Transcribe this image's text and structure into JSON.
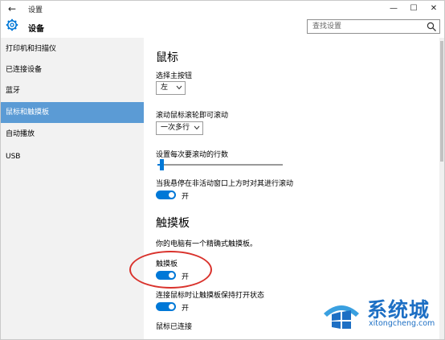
{
  "window": {
    "title": "设置",
    "app_name": "设备"
  },
  "search": {
    "placeholder": "查找设置"
  },
  "sidebar": {
    "items": [
      {
        "label": "打印机和扫描仪"
      },
      {
        "label": "已连接设备"
      },
      {
        "label": "蓝牙"
      },
      {
        "label": "鼠标和触摸板",
        "selected": true
      },
      {
        "label": "自动播放"
      },
      {
        "label": "USB"
      }
    ]
  },
  "mouse": {
    "heading": "鼠标",
    "primary_button_label": "选择主按钮",
    "primary_button_value": "左",
    "scroll_label": "滚动鼠标滚轮即可滚动",
    "scroll_value": "一次多行",
    "lines_label": "设置每次要滚动的行数",
    "lines_slider_level": 0.03,
    "inactive_scroll_label": "当我悬停在非活动窗口上方时对其进行滚动",
    "inactive_scroll_state": "开"
  },
  "touchpad": {
    "heading": "触摸板",
    "description": "你的电脑有一个精确式触摸板。",
    "toggle_label": "触摸板",
    "toggle_state": "开",
    "keep_on_label": "连接鼠标时让触摸板保持打开状态",
    "keep_on_state": "开",
    "mouse_connected_label": "鼠标已连接"
  },
  "watermark": {
    "name": "系统城",
    "url": "xitongcheng.com"
  },
  "colors": {
    "accent": "#0078d7",
    "selected_item": "#5b9bd5",
    "sidebar_bg": "#f2f2f2",
    "annotation_ring": "#d9322c",
    "watermark": "#1d6fc4"
  },
  "icons": {
    "back": "back-arrow-icon",
    "settings": "gear-icon",
    "search": "search-icon",
    "minimize": "minimize-icon",
    "maximize": "maximize-icon",
    "close": "close-icon",
    "dropdown": "chevron-down-icon",
    "watermark_logo": "windows-logo-icon"
  }
}
